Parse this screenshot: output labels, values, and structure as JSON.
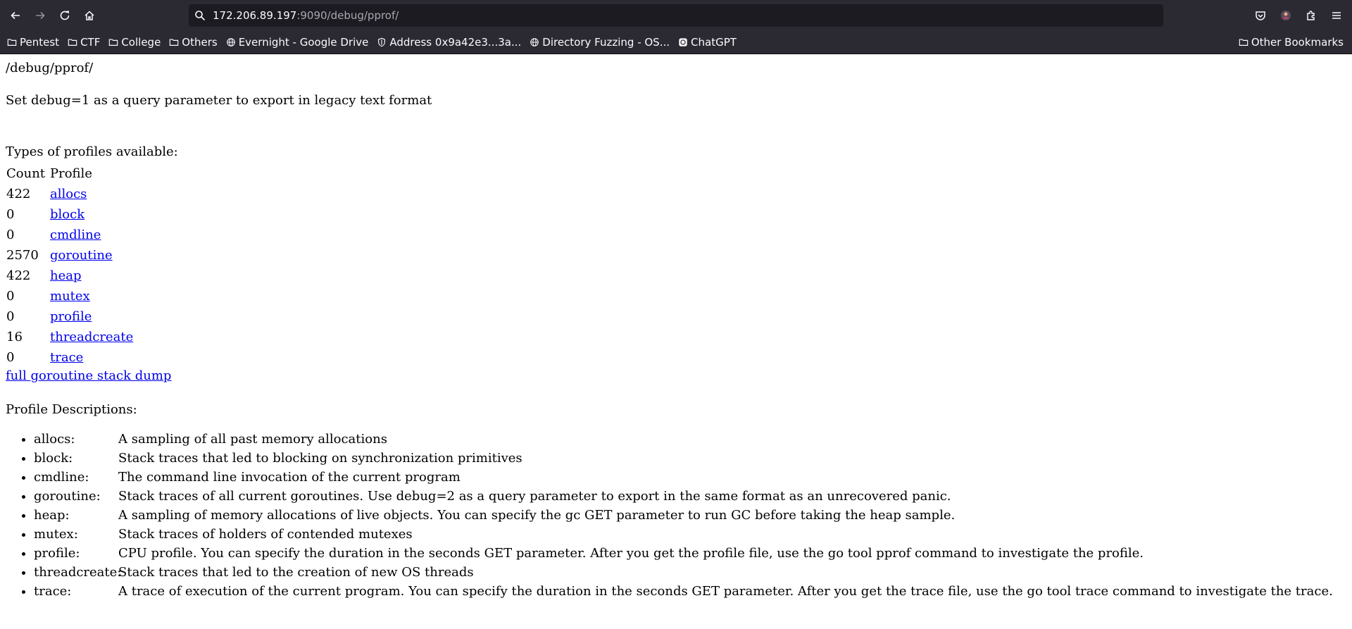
{
  "browser": {
    "url_host": "172.206.89.197",
    "url_rest": ":9090/debug/pprof/",
    "bookmarks": [
      {
        "label": "Pentest",
        "icon": "folder-icon"
      },
      {
        "label": "CTF",
        "icon": "folder-icon"
      },
      {
        "label": "College",
        "icon": "folder-icon"
      },
      {
        "label": "Others",
        "icon": "folder-icon"
      },
      {
        "label": "Evernight - Google Drive",
        "icon": "globe-icon"
      },
      {
        "label": "Address 0x9a42e3...3a...",
        "icon": "shield-icon"
      },
      {
        "label": "Directory Fuzzing - OS...",
        "icon": "globe-icon"
      },
      {
        "label": "ChatGPT",
        "icon": "chatgpt-icon"
      }
    ],
    "other_bookmarks": "Other Bookmarks"
  },
  "page": {
    "heading": "/debug/pprof/",
    "intro": "Set debug=1 as a query parameter to export in legacy text format",
    "types_label": "Types of profiles available:",
    "table_headers": {
      "count": "Count",
      "profile": "Profile"
    },
    "profiles": [
      {
        "count": "422",
        "name": "allocs"
      },
      {
        "count": "0",
        "name": "block"
      },
      {
        "count": "0",
        "name": "cmdline"
      },
      {
        "count": "2570",
        "name": "goroutine"
      },
      {
        "count": "422",
        "name": "heap"
      },
      {
        "count": "0",
        "name": "mutex"
      },
      {
        "count": "0",
        "name": "profile"
      },
      {
        "count": "16",
        "name": "threadcreate"
      },
      {
        "count": "0",
        "name": "trace"
      }
    ],
    "stack_dump_link": "full goroutine stack dump",
    "descriptions_label": "Profile Descriptions:",
    "descriptions": [
      {
        "name": "allocs:",
        "text": "A sampling of all past memory allocations"
      },
      {
        "name": "block:",
        "text": "Stack traces that led to blocking on synchronization primitives"
      },
      {
        "name": "cmdline:",
        "text": "The command line invocation of the current program"
      },
      {
        "name": "goroutine:",
        "text": "Stack traces of all current goroutines. Use debug=2 as a query parameter to export in the same format as an unrecovered panic."
      },
      {
        "name": "heap:",
        "text": "A sampling of memory allocations of live objects. You can specify the gc GET parameter to run GC before taking the heap sample."
      },
      {
        "name": "mutex:",
        "text": "Stack traces of holders of contended mutexes"
      },
      {
        "name": "profile:",
        "text": "CPU profile. You can specify the duration in the seconds GET parameter. After you get the profile file, use the go tool pprof command to investigate the profile."
      },
      {
        "name": "threadcreate:",
        "text": "Stack traces that led to the creation of new OS threads"
      },
      {
        "name": "trace:",
        "text": "A trace of execution of the current program. You can specify the duration in the seconds GET parameter. After you get the trace file, use the go tool trace command to investigate the trace."
      }
    ]
  }
}
